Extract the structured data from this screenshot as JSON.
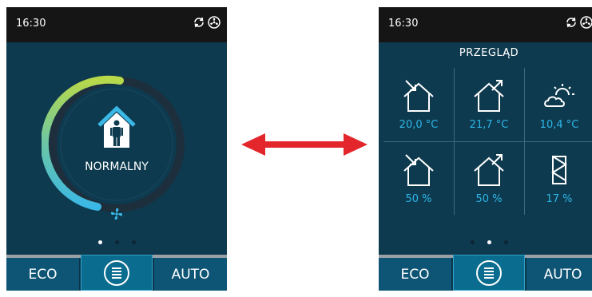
{
  "left_screen": {
    "time": "16:30",
    "mode_label": "NORMALNY",
    "active_page_index": 0,
    "buttons": {
      "eco": "ECO",
      "auto": "AUTO"
    },
    "ring_level_percent": 60
  },
  "right_screen": {
    "time": "16:30",
    "title": "PRZEGLĄD",
    "active_page_index": 1,
    "buttons": {
      "eco": "ECO",
      "auto": "AUTO"
    },
    "tiles": [
      {
        "icon": "house-air-in-icon",
        "value": "20,0 °C"
      },
      {
        "icon": "house-air-out-icon",
        "value": "21,7 °C"
      },
      {
        "icon": "sun-cloud-icon",
        "value": "10,4 °C"
      },
      {
        "icon": "house-air-in-icon",
        "value": "50 %"
      },
      {
        "icon": "house-air-out-icon",
        "value": "50 %"
      },
      {
        "icon": "filter-icon",
        "value": "17 %"
      }
    ]
  },
  "colors": {
    "screen_bg": "#0e3a4f",
    "status_bar": "#151515",
    "accent_value": "#2cb6e6",
    "button_bg": "#0e5575",
    "arrow": "#e3262b"
  }
}
